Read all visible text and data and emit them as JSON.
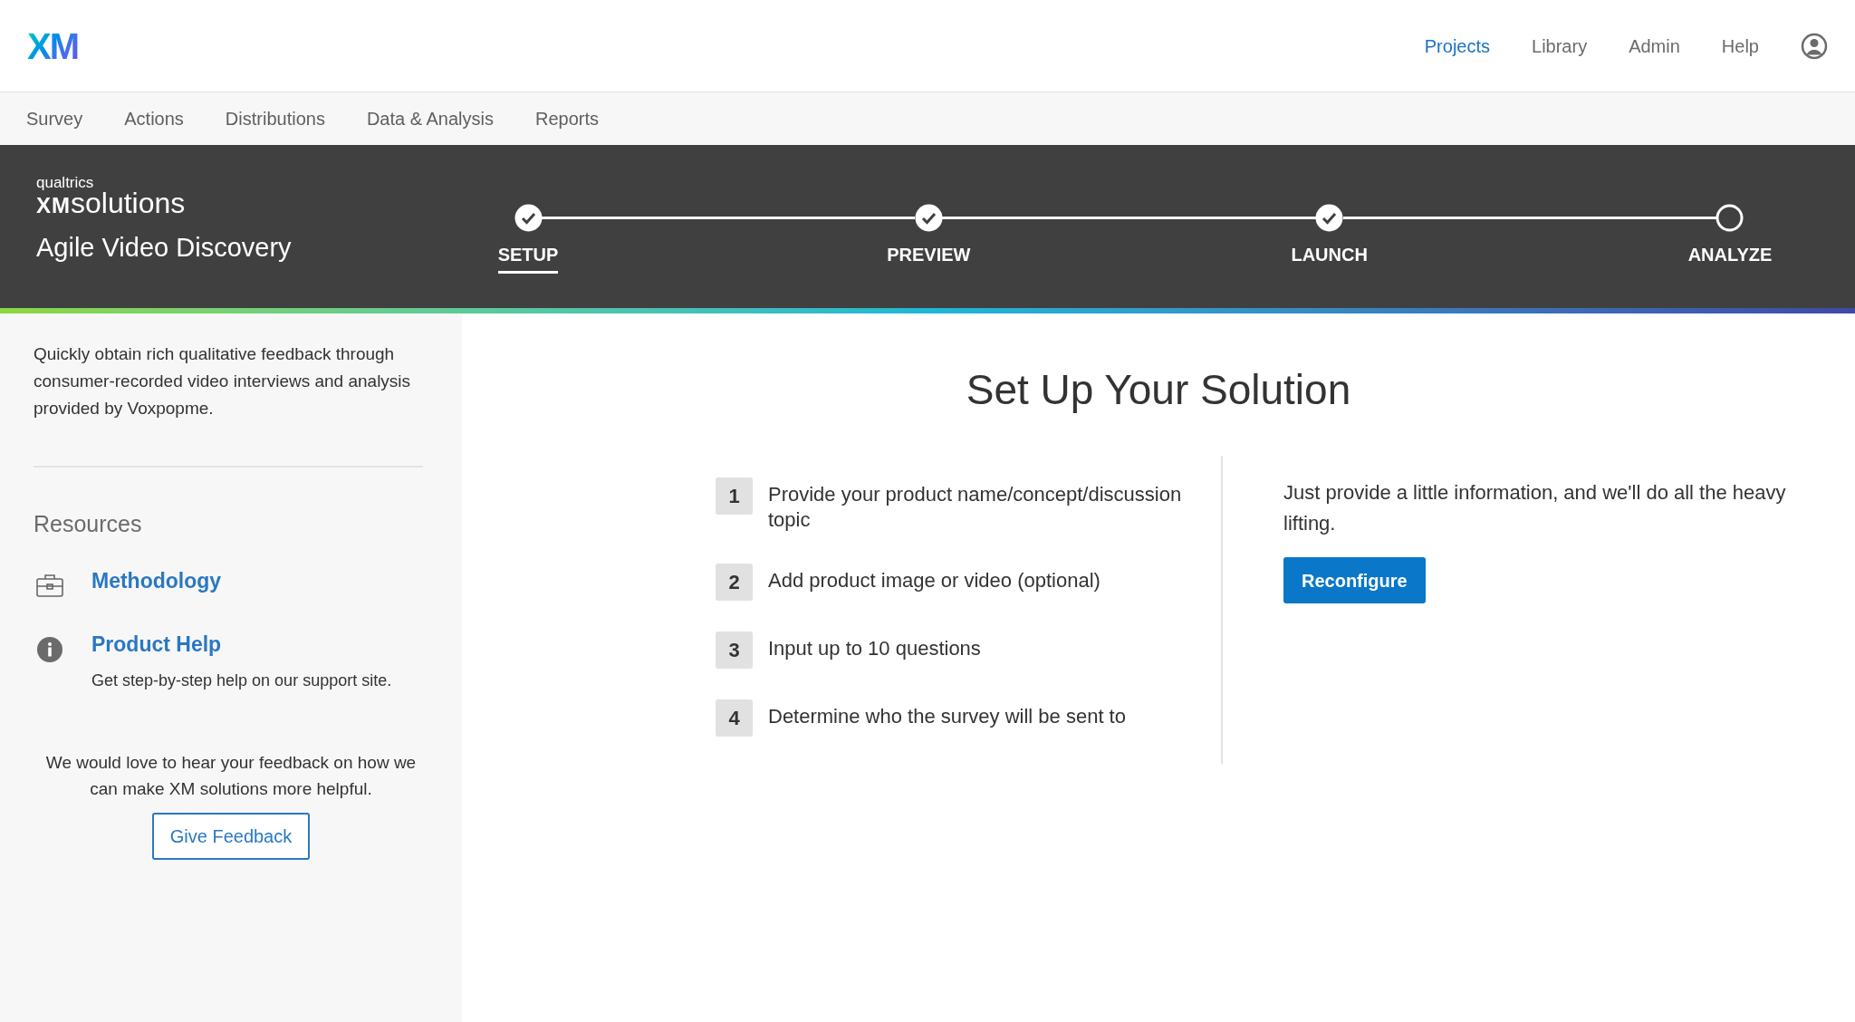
{
  "logo": "XM",
  "top_nav": [
    {
      "label": "Projects",
      "selected": true
    },
    {
      "label": "Library",
      "selected": false
    },
    {
      "label": "Admin",
      "selected": false
    },
    {
      "label": "Help",
      "selected": false
    }
  ],
  "sub_nav": [
    {
      "label": "Survey"
    },
    {
      "label": "Actions"
    },
    {
      "label": "Distributions"
    },
    {
      "label": "Data & Analysis"
    },
    {
      "label": "Reports"
    }
  ],
  "banner": {
    "brand_small": "qualtrics",
    "brand_xm": "XM",
    "brand_word": "solutions",
    "title": "Agile Video Discovery",
    "steps": [
      {
        "label": "SETUP",
        "done": true,
        "selected": true
      },
      {
        "label": "PREVIEW",
        "done": true,
        "selected": false
      },
      {
        "label": "LAUNCH",
        "done": true,
        "selected": false
      },
      {
        "label": "ANALYZE",
        "done": false,
        "selected": false
      }
    ]
  },
  "sidebar": {
    "description": "Quickly obtain rich qualitative feedback through consumer-recorded video interviews and analysis provided by Voxpopme.",
    "resources_heading": "Resources",
    "resources": [
      {
        "kind": "briefcase",
        "title": "Methodology"
      },
      {
        "kind": "info",
        "title": "Product Help",
        "subtitle": "Get step-by-step help on our support site."
      }
    ],
    "feedback_text": "We would love to hear your feedback on how we can make XM solutions more helpful.",
    "feedback_button": "Give Feedback"
  },
  "main": {
    "title": "Set Up Your Solution",
    "steps": [
      {
        "number": "1",
        "text": "Provide your product name/concept/discussion topic"
      },
      {
        "number": "2",
        "text": "Add product image or video (optional)"
      },
      {
        "number": "3",
        "text": "Input up to 10 questions"
      },
      {
        "number": "4",
        "text": "Determine who the survey will be sent to"
      }
    ],
    "info": "Just provide a little information, and we'll do all the heavy lifting.",
    "button": "Reconfigure"
  }
}
